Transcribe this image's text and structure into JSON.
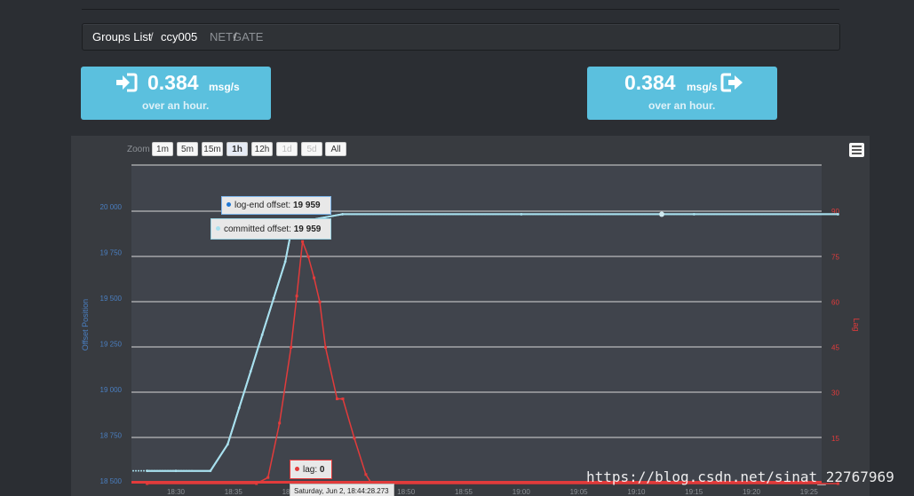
{
  "breadcrumb": {
    "items": [
      {
        "label": "Groups List"
      },
      {
        "label": "/"
      },
      {
        "label": "ccy005"
      },
      {
        "label": "/"
      },
      {
        "label": "NETGATE"
      }
    ]
  },
  "stats": {
    "incoming": {
      "value": "0.384",
      "unit": "msg/s",
      "sub": "over an hour.",
      "icon": "sign-in-icon"
    },
    "outgoing": {
      "value": "0.384",
      "unit": "msg/s",
      "sub": "over an hour.",
      "icon": "sign-out-icon"
    }
  },
  "zoom": {
    "label": "Zoom",
    "buttons": [
      "1m",
      "5m",
      "15m",
      "1h",
      "12h",
      "1d",
      "5d",
      "All"
    ],
    "active": "1h",
    "disabled": [
      "1d",
      "5d"
    ]
  },
  "tooltips": {
    "log_end": {
      "label": "log-end offset:",
      "value": "19 959"
    },
    "committed": {
      "label": "committed offset:",
      "value": "19 959"
    },
    "lag": {
      "label": "lag:",
      "value": "0"
    },
    "date": "Saturday, Jun 2, 18:44:28.273"
  },
  "watermark": "https://blog.csdn.net/sinat_22767969",
  "colors": {
    "offset_series": "#a8e0ee",
    "lag_series": "#e23b3b",
    "left_axis": "#4a7fc1",
    "right_axis": "#e23b3b",
    "plot_bg": "#40444c",
    "accent": "#5bc0de"
  },
  "chart_data": {
    "type": "line",
    "xlabel": "",
    "ylabel": "Offset Position",
    "ylabel_right": "Lag",
    "x_ticks": [
      "18:30",
      "18:35",
      "18:40",
      "18:45",
      "18:50",
      "18:55",
      "19:00",
      "19:05",
      "19:10",
      "19:15",
      "19:20",
      "19:25"
    ],
    "y_ticks": [
      "18 500",
      "18 750",
      "19 000",
      "19 250",
      "19 500",
      "19 750",
      "20 000"
    ],
    "y_right_ticks": [
      "15",
      "30",
      "45",
      "60",
      "75",
      "90"
    ],
    "ylim": [
      18500,
      20250
    ],
    "ylim_right": [
      0,
      105
    ],
    "grid": true,
    "series": [
      {
        "name": "log-end offset",
        "axis": "left",
        "points": [
          [
            "18:27:30",
            18555
          ],
          [
            "18:30:00",
            18555
          ],
          [
            "18:33:00",
            18555
          ],
          [
            "18:34:30",
            18700
          ],
          [
            "18:35:30",
            18900
          ],
          [
            "18:36:30",
            19100
          ],
          [
            "18:37:30",
            19300
          ],
          [
            "18:38:30",
            19500
          ],
          [
            "18:39:30",
            19700
          ],
          [
            "18:40:00",
            19860
          ],
          [
            "18:41:00",
            19920
          ],
          [
            "18:44:28",
            19959
          ],
          [
            "19:00:00",
            19959
          ],
          [
            "19:15:00",
            19959
          ],
          [
            "19:27:30",
            19959
          ]
        ]
      },
      {
        "name": "committed offset",
        "axis": "left",
        "points": [
          [
            "18:27:30",
            18555
          ],
          [
            "18:30:00",
            18555
          ],
          [
            "18:33:00",
            18555
          ],
          [
            "18:34:30",
            18700
          ],
          [
            "18:35:30",
            18900
          ],
          [
            "18:36:30",
            19100
          ],
          [
            "18:37:30",
            19300
          ],
          [
            "18:38:30",
            19500
          ],
          [
            "18:39:30",
            19700
          ],
          [
            "18:40:00",
            19860
          ],
          [
            "18:41:00",
            19920
          ],
          [
            "18:44:28",
            19959
          ],
          [
            "19:00:00",
            19959
          ],
          [
            "19:15:00",
            19959
          ],
          [
            "19:27:30",
            19959
          ]
        ]
      },
      {
        "name": "lag",
        "axis": "right",
        "points": [
          [
            "18:27:30",
            0
          ],
          [
            "18:37:00",
            0
          ],
          [
            "18:38:00",
            2
          ],
          [
            "18:39:00",
            20
          ],
          [
            "18:40:00",
            45
          ],
          [
            "18:40:30",
            62
          ],
          [
            "18:41:00",
            80
          ],
          [
            "18:41:30",
            75
          ],
          [
            "18:42:00",
            68
          ],
          [
            "18:42:30",
            60
          ],
          [
            "18:43:00",
            45
          ],
          [
            "18:44:00",
            28
          ],
          [
            "18:44:30",
            28
          ],
          [
            "18:45:30",
            15
          ],
          [
            "18:46:30",
            3
          ],
          [
            "18:47:00",
            0
          ],
          [
            "19:27:30",
            0
          ]
        ]
      }
    ]
  }
}
